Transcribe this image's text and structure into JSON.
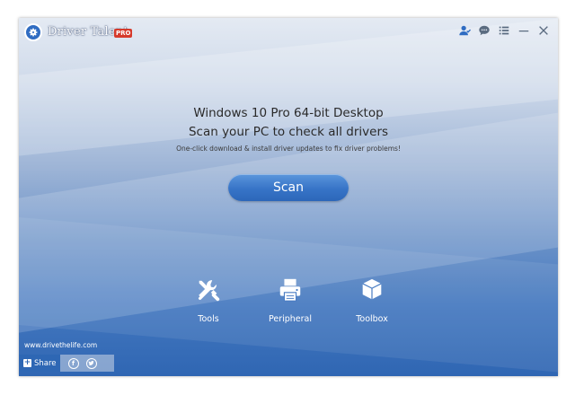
{
  "app": {
    "name": "Driver Talent",
    "badge": "PRO",
    "logo_icon": "gear-icon"
  },
  "window_controls": {
    "icons": [
      "user-support-icon",
      "chat-icon",
      "menu-icon",
      "minimize-icon",
      "close-icon"
    ]
  },
  "main": {
    "os_label": "Windows 10 Pro 64-bit Desktop",
    "headline": "Scan your PC to check all drivers",
    "subline": "One-click download & install driver updates to fix driver problems!",
    "scan_button": "Scan"
  },
  "tools": [
    {
      "label": "Tools",
      "icon": "wrench-screwdriver-icon"
    },
    {
      "label": "Peripheral",
      "icon": "printer-icon"
    },
    {
      "label": "Toolbox",
      "icon": "cube-icon"
    }
  ],
  "footer": {
    "website": "www.drivethelife.com",
    "share_label": "Share",
    "social_icons": [
      "facebook-icon",
      "twitter-icon"
    ]
  },
  "colors": {
    "accent": "#3774c7",
    "badge": "#d63a2b",
    "share": "#2e67b4"
  }
}
